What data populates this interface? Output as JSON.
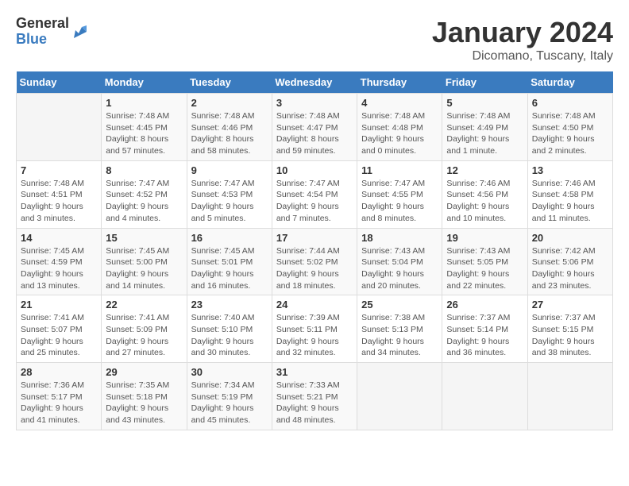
{
  "logo": {
    "general": "General",
    "blue": "Blue"
  },
  "title": "January 2024",
  "subtitle": "Dicomano, Tuscany, Italy",
  "days_of_week": [
    "Sunday",
    "Monday",
    "Tuesday",
    "Wednesday",
    "Thursday",
    "Friday",
    "Saturday"
  ],
  "weeks": [
    [
      {
        "day": "",
        "info": ""
      },
      {
        "day": "1",
        "info": "Sunrise: 7:48 AM\nSunset: 4:45 PM\nDaylight: 8 hours\nand 57 minutes."
      },
      {
        "day": "2",
        "info": "Sunrise: 7:48 AM\nSunset: 4:46 PM\nDaylight: 8 hours\nand 58 minutes."
      },
      {
        "day": "3",
        "info": "Sunrise: 7:48 AM\nSunset: 4:47 PM\nDaylight: 8 hours\nand 59 minutes."
      },
      {
        "day": "4",
        "info": "Sunrise: 7:48 AM\nSunset: 4:48 PM\nDaylight: 9 hours\nand 0 minutes."
      },
      {
        "day": "5",
        "info": "Sunrise: 7:48 AM\nSunset: 4:49 PM\nDaylight: 9 hours\nand 1 minute."
      },
      {
        "day": "6",
        "info": "Sunrise: 7:48 AM\nSunset: 4:50 PM\nDaylight: 9 hours\nand 2 minutes."
      }
    ],
    [
      {
        "day": "7",
        "info": "Sunrise: 7:48 AM\nSunset: 4:51 PM\nDaylight: 9 hours\nand 3 minutes."
      },
      {
        "day": "8",
        "info": "Sunrise: 7:47 AM\nSunset: 4:52 PM\nDaylight: 9 hours\nand 4 minutes."
      },
      {
        "day": "9",
        "info": "Sunrise: 7:47 AM\nSunset: 4:53 PM\nDaylight: 9 hours\nand 5 minutes."
      },
      {
        "day": "10",
        "info": "Sunrise: 7:47 AM\nSunset: 4:54 PM\nDaylight: 9 hours\nand 7 minutes."
      },
      {
        "day": "11",
        "info": "Sunrise: 7:47 AM\nSunset: 4:55 PM\nDaylight: 9 hours\nand 8 minutes."
      },
      {
        "day": "12",
        "info": "Sunrise: 7:46 AM\nSunset: 4:56 PM\nDaylight: 9 hours\nand 10 minutes."
      },
      {
        "day": "13",
        "info": "Sunrise: 7:46 AM\nSunset: 4:58 PM\nDaylight: 9 hours\nand 11 minutes."
      }
    ],
    [
      {
        "day": "14",
        "info": "Sunrise: 7:45 AM\nSunset: 4:59 PM\nDaylight: 9 hours\nand 13 minutes."
      },
      {
        "day": "15",
        "info": "Sunrise: 7:45 AM\nSunset: 5:00 PM\nDaylight: 9 hours\nand 14 minutes."
      },
      {
        "day": "16",
        "info": "Sunrise: 7:45 AM\nSunset: 5:01 PM\nDaylight: 9 hours\nand 16 minutes."
      },
      {
        "day": "17",
        "info": "Sunrise: 7:44 AM\nSunset: 5:02 PM\nDaylight: 9 hours\nand 18 minutes."
      },
      {
        "day": "18",
        "info": "Sunrise: 7:43 AM\nSunset: 5:04 PM\nDaylight: 9 hours\nand 20 minutes."
      },
      {
        "day": "19",
        "info": "Sunrise: 7:43 AM\nSunset: 5:05 PM\nDaylight: 9 hours\nand 22 minutes."
      },
      {
        "day": "20",
        "info": "Sunrise: 7:42 AM\nSunset: 5:06 PM\nDaylight: 9 hours\nand 23 minutes."
      }
    ],
    [
      {
        "day": "21",
        "info": "Sunrise: 7:41 AM\nSunset: 5:07 PM\nDaylight: 9 hours\nand 25 minutes."
      },
      {
        "day": "22",
        "info": "Sunrise: 7:41 AM\nSunset: 5:09 PM\nDaylight: 9 hours\nand 27 minutes."
      },
      {
        "day": "23",
        "info": "Sunrise: 7:40 AM\nSunset: 5:10 PM\nDaylight: 9 hours\nand 30 minutes."
      },
      {
        "day": "24",
        "info": "Sunrise: 7:39 AM\nSunset: 5:11 PM\nDaylight: 9 hours\nand 32 minutes."
      },
      {
        "day": "25",
        "info": "Sunrise: 7:38 AM\nSunset: 5:13 PM\nDaylight: 9 hours\nand 34 minutes."
      },
      {
        "day": "26",
        "info": "Sunrise: 7:37 AM\nSunset: 5:14 PM\nDaylight: 9 hours\nand 36 minutes."
      },
      {
        "day": "27",
        "info": "Sunrise: 7:37 AM\nSunset: 5:15 PM\nDaylight: 9 hours\nand 38 minutes."
      }
    ],
    [
      {
        "day": "28",
        "info": "Sunrise: 7:36 AM\nSunset: 5:17 PM\nDaylight: 9 hours\nand 41 minutes."
      },
      {
        "day": "29",
        "info": "Sunrise: 7:35 AM\nSunset: 5:18 PM\nDaylight: 9 hours\nand 43 minutes."
      },
      {
        "day": "30",
        "info": "Sunrise: 7:34 AM\nSunset: 5:19 PM\nDaylight: 9 hours\nand 45 minutes."
      },
      {
        "day": "31",
        "info": "Sunrise: 7:33 AM\nSunset: 5:21 PM\nDaylight: 9 hours\nand 48 minutes."
      },
      {
        "day": "",
        "info": ""
      },
      {
        "day": "",
        "info": ""
      },
      {
        "day": "",
        "info": ""
      }
    ]
  ]
}
